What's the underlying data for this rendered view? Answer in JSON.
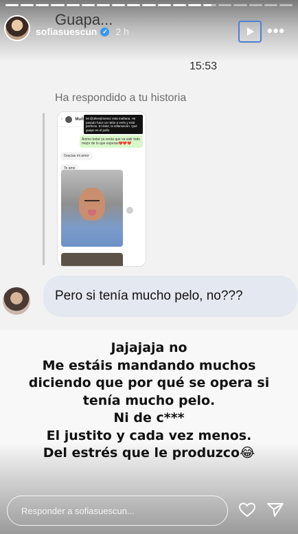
{
  "progress": [
    1,
    1,
    1,
    1,
    1,
    1,
    1,
    1,
    1,
    1,
    1,
    1,
    1,
    0.6,
    0,
    0,
    0,
    0,
    0
  ],
  "header": {
    "background_title": "Guapa...",
    "username": "sofiasuescun",
    "posted_ago": "2 h",
    "verified_icon": "verified-badge-icon",
    "play_icon": "play-icon",
    "more_icon": "more-options-icon"
  },
  "chat": {
    "timestamp": "15:53",
    "replied_label": "Ha respondido a tu historia",
    "nested_story": {
      "contact": "Muñeco❤️",
      "date": "Ayer",
      "green_message": "Ánimo bebé ya verás que va salir todo mejor de lo que esperas❤️❤️❤️",
      "message_1": "Gracias mi amor",
      "message_2": "Te amo",
      "photo_caption": "Mi @oliverjimenez esta mañana. He pasado hace un ratito a verlo y está perfecto. El dolor, la inflamación. Qué guapo es el jodío"
    },
    "reply_message": "Pero si tenía mucho pelo,  no???"
  },
  "caption": {
    "lines": [
      "Jajajaja no",
      "Me estáis mandando muchos",
      "diciendo que por qué se opera si",
      "tenía mucho pelo.",
      "Ni de c***",
      "El justito y cada vez menos.",
      "Del estrés que le produzco😂"
    ]
  },
  "footer": {
    "reply_placeholder": "Responder a sofiasuescun...",
    "like_icon": "heart-icon",
    "share_icon": "send-icon"
  },
  "colors": {
    "reply_bubble": "#e4e8f0",
    "verified": "#3897f0",
    "play_outline": "#4a7fd6"
  }
}
